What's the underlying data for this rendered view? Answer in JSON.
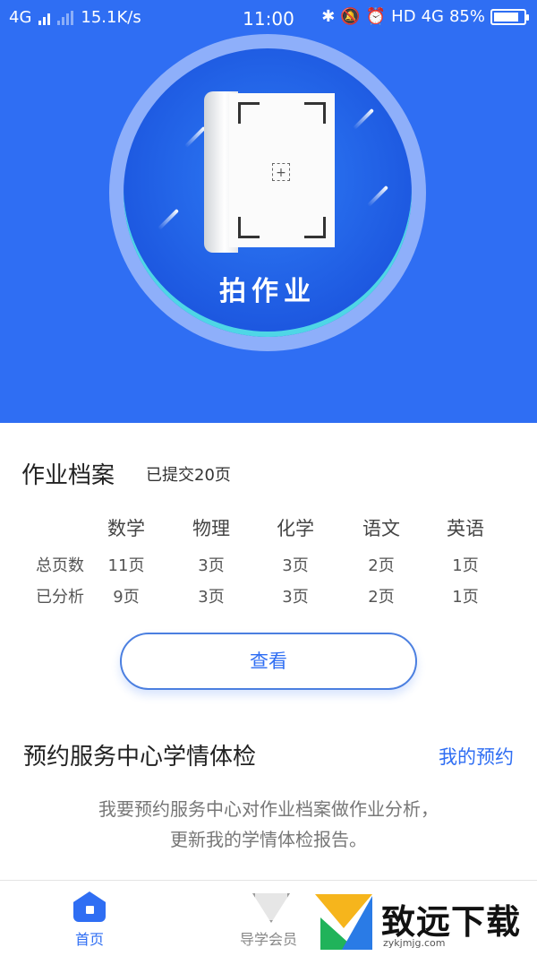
{
  "status_bar": {
    "network_left": "4G",
    "speed": "15.1K/s",
    "time": "11:00",
    "hd_label": "HD",
    "network_right": "4G",
    "battery_percent": "85%",
    "battery_level": 0.85
  },
  "camera": {
    "label": "拍作业",
    "icon": "book-scan-icon"
  },
  "archive": {
    "title": "作业档案",
    "submitted": "已提交20页",
    "subjects": [
      "数学",
      "物理",
      "化学",
      "语文",
      "英语"
    ],
    "rows": [
      {
        "label": "总页数",
        "values": [
          "11页",
          "3页",
          "3页",
          "2页",
          "1页"
        ]
      },
      {
        "label": "已分析",
        "values": [
          "9页",
          "3页",
          "3页",
          "2页",
          "1页"
        ]
      }
    ],
    "view_button": "查看"
  },
  "service": {
    "title": "预约服务中心学情体检",
    "link": "我的预约",
    "description_line1": "我要预约服务中心对作业档案做作业分析，",
    "description_line2": "更新我的学情体检报告。"
  },
  "bottom_nav": {
    "items": [
      {
        "label": "首页",
        "icon": "home-icon",
        "active": true
      },
      {
        "label": "导学会员",
        "icon": "member-icon",
        "active": false
      }
    ]
  },
  "watermark": {
    "brand": "致远下载",
    "domain": "zykjmjg.com"
  },
  "colors": {
    "primary": "#2f6ef3",
    "hero_bg": "#2f6ef3",
    "text_dark": "#222222",
    "text_muted": "#777777"
  }
}
